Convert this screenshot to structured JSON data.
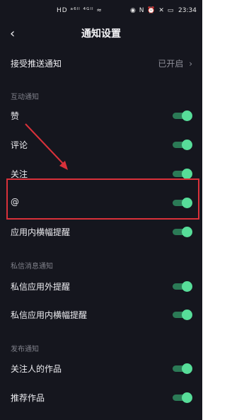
{
  "status_bar": {
    "left_icons": "HD ᵃ⁶ˡˡ ⁴ᴳˡˡ ≈",
    "right_icons": "◉ N ⏰ ✕ ▭",
    "time": "23:34"
  },
  "header": {
    "back_icon": "‹",
    "title": "通知设置"
  },
  "push": {
    "label": "接受推送通知",
    "value": "已开启",
    "chevron": "›"
  },
  "sections": {
    "interaction": {
      "title": "互动通知",
      "items": [
        {
          "label": "赞",
          "on": true
        },
        {
          "label": "评论",
          "on": true
        },
        {
          "label": "关注",
          "on": true
        },
        {
          "label": "@",
          "on": true
        },
        {
          "label": "应用内横幅提醒",
          "on": true
        }
      ]
    },
    "messages": {
      "title": "私信消息通知",
      "items": [
        {
          "label": "私信应用外提醒",
          "on": true
        },
        {
          "label": "私信应用内横幅提醒",
          "on": true
        }
      ]
    },
    "publish": {
      "title": "发布通知",
      "items": [
        {
          "label": "关注人的作品",
          "on": true
        },
        {
          "label": "推荐作品",
          "on": true
        }
      ]
    }
  },
  "colors": {
    "background": "#15161e",
    "toggle_on": "#57dd99",
    "annotation": "#d9313a"
  }
}
